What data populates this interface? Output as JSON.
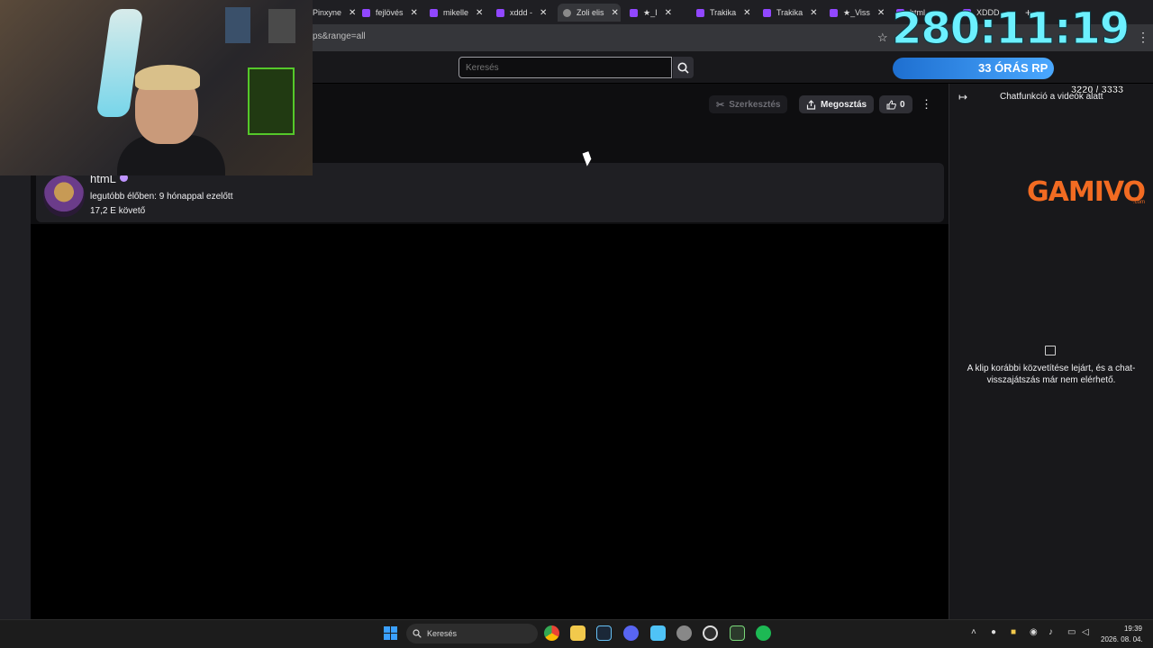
{
  "browser": {
    "tabs": [
      {
        "label": "Pinxyne",
        "active": false
      },
      {
        "label": "fejlövés",
        "active": false
      },
      {
        "label": "mikelle",
        "active": false
      },
      {
        "label": "xddd -",
        "active": false
      },
      {
        "label": "Zoli elis",
        "active": true
      },
      {
        "label": "★_I",
        "active": false
      },
      {
        "label": "Trakika",
        "active": false
      },
      {
        "label": "Trakika",
        "active": false
      },
      {
        "label": "★_Viss",
        "active": false
      },
      {
        "label": "html_",
        "active": false
      },
      {
        "label": "XDDD",
        "active": false
      }
    ],
    "new_tab_label": "+",
    "url": "ps&range=all"
  },
  "nav": {
    "search_placeholder": "Keresés"
  },
  "clip_actions": {
    "edit_label": "Szerkesztés",
    "share_label": "Megosztás",
    "like_count": "0"
  },
  "channel": {
    "name": "htmL",
    "last_live": "legutóbb élőben: 9 hónappal ezelőtt",
    "followers": "17,2 E követő"
  },
  "chat": {
    "title": "Chatfunkció a videók alatt",
    "sponsor": "GAMIVO",
    "sponsor_sub": ".com",
    "replay_message": "A klip korábbi közvetítése lejárt, és a chat-visszajátszás már nem elérhető."
  },
  "overlay": {
    "timer": "280:11:19",
    "subathon_label": "33 ÓRÁS RP",
    "goal_counter": "3220 / 3333"
  },
  "taskbar": {
    "search_label": "Keresés",
    "time": "19:39",
    "date": "2026. 08. 04.",
    "apps": [
      "chrome-icon",
      "file-explorer-icon",
      "steam-icon",
      "discord-icon",
      "notepad-icon",
      "settings-icon",
      "logitech-icon",
      "game-icon",
      "spotify-icon"
    ]
  },
  "colors": {
    "accent": "#9147ff",
    "timer": "#6cf0ff",
    "sponsor": "#f26b22"
  }
}
